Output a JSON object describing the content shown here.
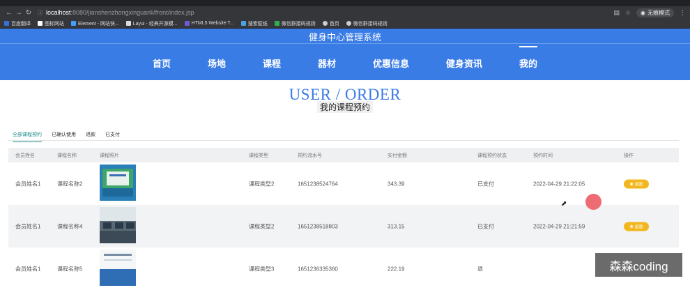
{
  "browser": {
    "url_host": "localhost",
    "url_path": ":8080/jianshenzhongxinguanli/front/index.jsp",
    "incognito_label": "无痕模式",
    "bookmarks": [
      "百度翻译",
      "图标网站",
      "Element - 网站快...",
      "Layui - 经典开源模...",
      "HTML5 Website T...",
      "搜索壁纸",
      "微信群接码规则",
      "首页",
      "微信群接码规则"
    ]
  },
  "header": {
    "site_title": "健身中心管理系统",
    "menu": [
      "首页",
      "场地",
      "课程",
      "器材",
      "优惠信息",
      "健身资讯",
      "我的"
    ],
    "active_menu": "我的"
  },
  "banner": {
    "en": "USER / ORDER",
    "cn": "我的课程预约"
  },
  "tabs": [
    "全部课程预约",
    "已确认使用",
    "退款",
    "已支付"
  ],
  "table": {
    "columns": [
      "会员姓名",
      "课程名称",
      "课程照片",
      "课程类型",
      "预约流水号",
      "实付金额",
      "课程预约状态",
      "预约时间",
      "操作"
    ],
    "rows": [
      {
        "name": "会员姓名1",
        "course": "课程名称2",
        "type": "课程类型2",
        "serial": "1651238524764",
        "amount": "343.39",
        "status": "已支付",
        "time": "2022-04-29 21:22:05",
        "action": "退款"
      },
      {
        "name": "会员姓名1",
        "course": "课程名称4",
        "type": "课程类型2",
        "serial": "1651238518803",
        "amount": "313.15",
        "status": "已支付",
        "time": "2022-04-29 21:21:59",
        "action": "退款"
      },
      {
        "name": "会员姓名1",
        "course": "课程名称5",
        "type": "课程类型3",
        "serial": "1651236335360",
        "amount": "222.19",
        "status": "退",
        "time": "",
        "action": ""
      }
    ]
  },
  "watermark": "森森coding",
  "colors": {
    "primary": "#3a7ce6",
    "tab_active": "#1f8b8b",
    "pay_button": "#f2b71e"
  }
}
